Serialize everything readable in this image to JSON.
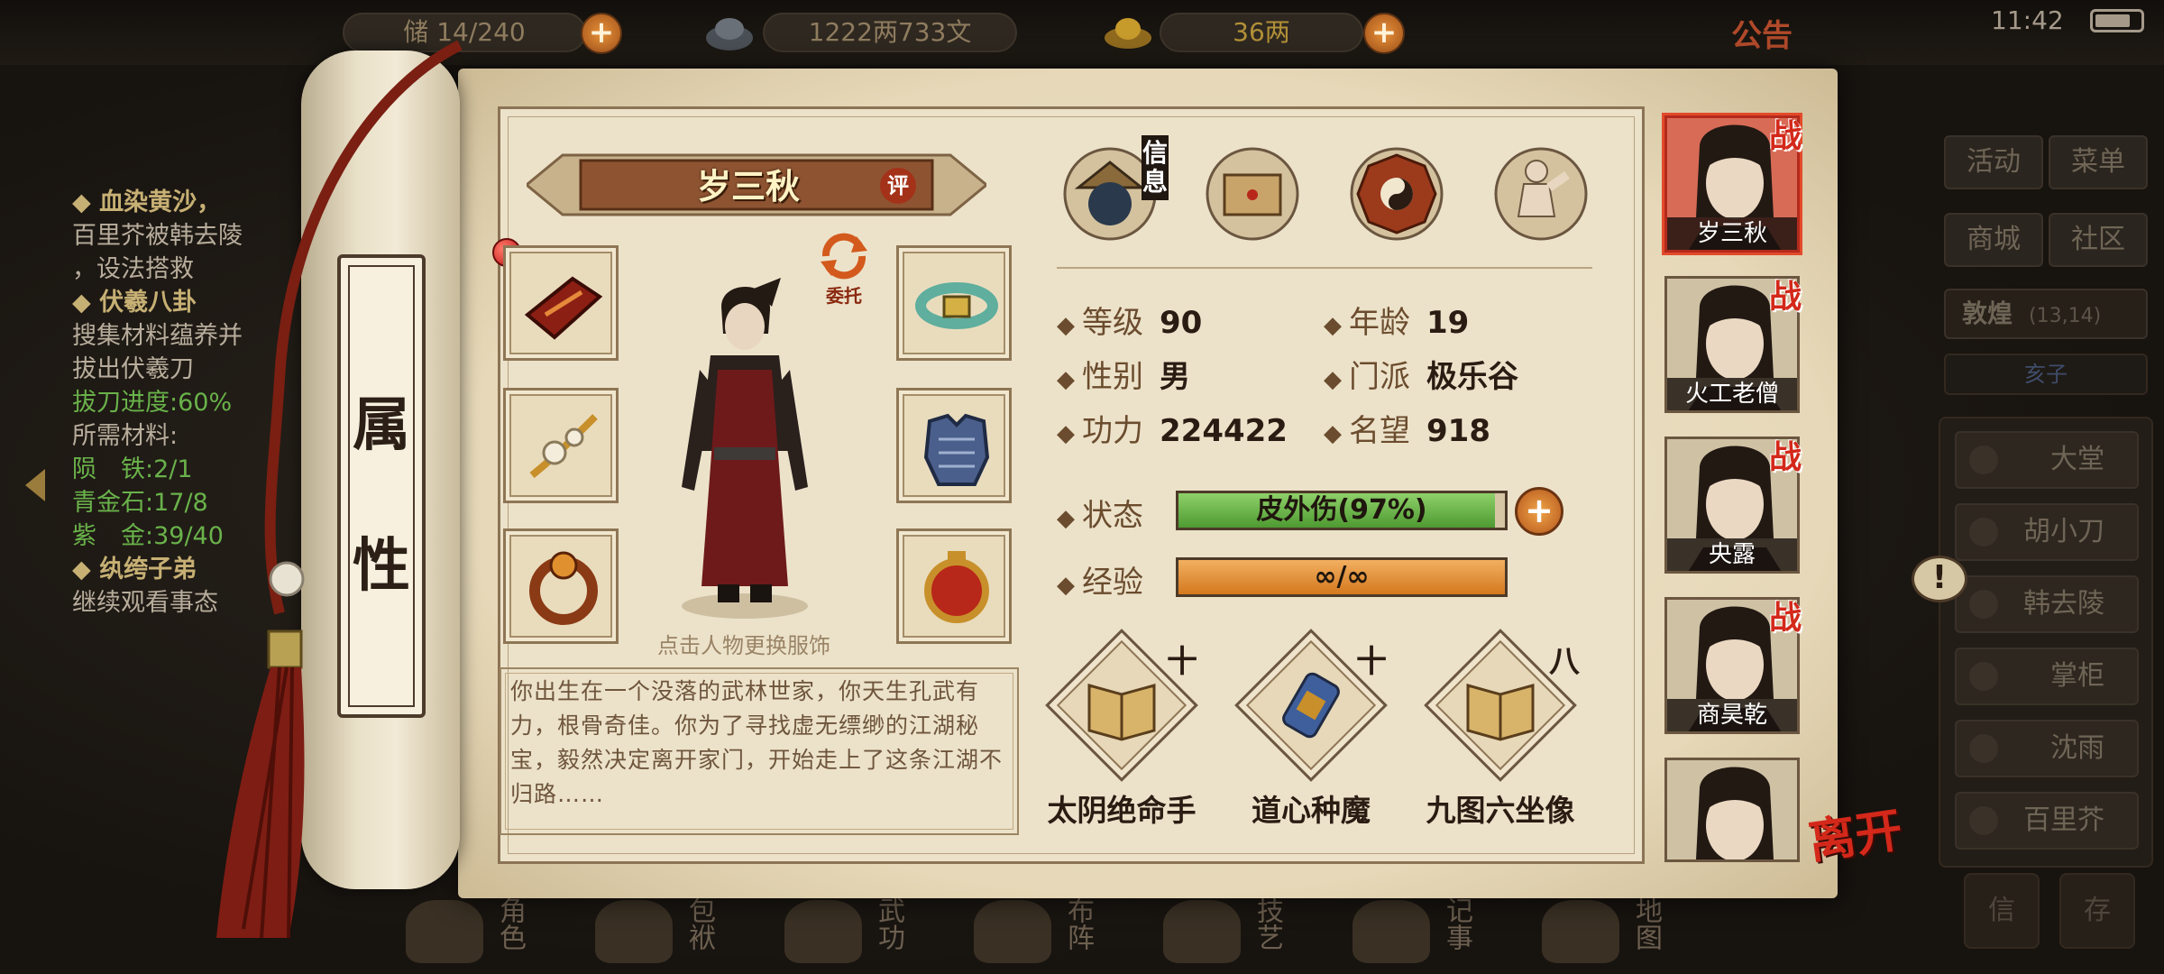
{
  "top_bar": {
    "capacity": "14/240",
    "capacity_prefix": "储",
    "money": "1222两733文",
    "gold": "36两",
    "notice": "公告",
    "time": "11:42"
  },
  "quests": [
    {
      "type": "title",
      "text": "◆ 血染黄沙，"
    },
    {
      "type": "text",
      "text": "百里芥被韩去陵"
    },
    {
      "type": "text",
      "text": "，设法搭救"
    },
    {
      "type": "title",
      "text": "◆ 伏羲八卦"
    },
    {
      "type": "text",
      "text": "搜集材料蕴养并"
    },
    {
      "type": "text",
      "text": "拔出伏羲刀"
    },
    {
      "type": "green",
      "text": "拔刀进度:60%"
    },
    {
      "type": "text",
      "text": "所需材料:"
    },
    {
      "type": "green",
      "text": "陨　铁:2/1"
    },
    {
      "type": "green",
      "text": "青金石:17/8"
    },
    {
      "type": "green",
      "text": "紫　金:39/40"
    },
    {
      "type": "title",
      "text": "◆ 纨绔子弟"
    },
    {
      "type": "text",
      "text": "继续观看事态"
    }
  ],
  "scroll": {
    "tab_chars": [
      "属",
      "性"
    ]
  },
  "character": {
    "name": "岁三秋",
    "rate_badge": "评",
    "delegate": "委托",
    "hint": "点击人物更换服饰",
    "bio": "你出生在一个没落的武林世家，你天生孔武有力，根骨奇佳。你为了寻找虚无缥缈的江湖秘宝，毅然决定离开家门，开始走上了这条江湖不归路……"
  },
  "info_tabs": {
    "active_label": "信息"
  },
  "stats": {
    "level_label": "等级",
    "level": "90",
    "age_label": "年龄",
    "age": "19",
    "gender_label": "性别",
    "gender": "男",
    "sect_label": "门派",
    "sect": "极乐谷",
    "power_label": "功力",
    "power": "224422",
    "fame_label": "名望",
    "fame": "918",
    "status_label": "状态",
    "status": "皮外伤(97%)",
    "status_fraction": 0.97,
    "exp_label": "经验",
    "exp": "∞/∞",
    "exp_fraction": 1.0
  },
  "skills": [
    {
      "name": "太阴绝命手",
      "mark": "十"
    },
    {
      "name": "道心种魔",
      "mark": "十"
    },
    {
      "name": "九图六坐像",
      "mark": "八"
    }
  ],
  "party": [
    {
      "name": "岁三秋",
      "tag": "战"
    },
    {
      "name": "火工老僧",
      "tag": "战"
    },
    {
      "name": "央露",
      "tag": "战"
    },
    {
      "name": "商昊乾",
      "tag": "战"
    },
    {
      "name": "",
      "tag": ""
    }
  ],
  "leave_label": "离开",
  "right_menu": {
    "buttons": [
      "活动",
      "菜单",
      "商城",
      "社区"
    ],
    "location": "敦煌",
    "location_coords": "(13,14)",
    "time_of_day": "亥子",
    "npcs": [
      "大堂",
      "胡小刀",
      "韩去陵",
      "掌柜",
      "沈雨",
      "百里芥"
    ],
    "bottom_buttons": [
      "信",
      "存"
    ],
    "alert": "!"
  },
  "bottom_nav": [
    {
      "label": "角色"
    },
    {
      "label": "包袱"
    },
    {
      "label": "武功"
    },
    {
      "label": "布阵"
    },
    {
      "label": "技艺"
    },
    {
      "label": "记事"
    },
    {
      "label": "地图"
    }
  ],
  "colors": {
    "status_bar": "#6bb84a",
    "exp_bar": "#e69a3a",
    "accent_red": "#d3281a"
  }
}
